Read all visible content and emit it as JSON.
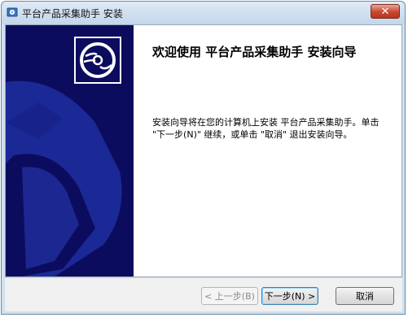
{
  "window": {
    "title": "平台产品采集助手 安装",
    "close_label": "✕"
  },
  "colors": {
    "side_panel": "#0c0c5e",
    "side_panel_accent": "#1f2fa0",
    "title_bar": "#c3d6ea",
    "close_button": "#c7472f"
  },
  "icons": {
    "app": "installer-app-icon",
    "logo": "disc-icon",
    "close": "close-icon"
  },
  "wizard": {
    "heading": "欢迎使用 平台产品采集助手 安装向导",
    "description": "安装向导将在您的计算机上安装 平台产品采集助手。单击 \"下一步(N)\" 继续，或单击 \"取消\" 退出安装向导。"
  },
  "buttons": {
    "back": "< 上一步(B)",
    "next": "下一步(N) >",
    "cancel": "取消"
  }
}
